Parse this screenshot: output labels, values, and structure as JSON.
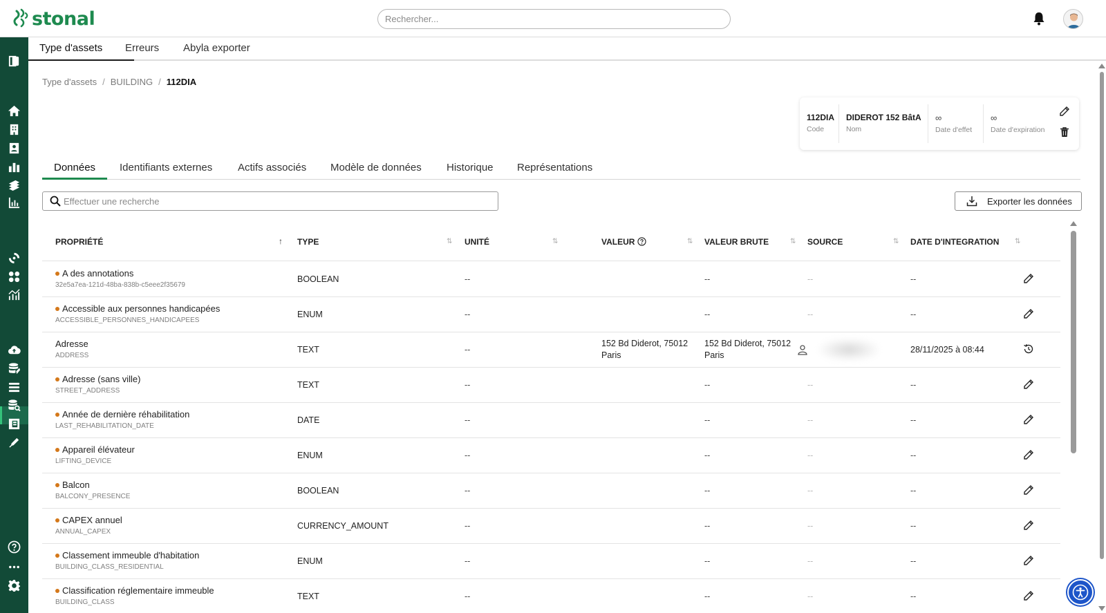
{
  "header": {
    "brand": "stonal",
    "search_placeholder": "Rechercher..."
  },
  "main_tabs": [
    {
      "label": "Type d'assets",
      "active": true
    },
    {
      "label": "Erreurs",
      "active": false
    },
    {
      "label": "Abyla exporter",
      "active": false
    }
  ],
  "breadcrumb": {
    "items": [
      "Type d'assets",
      "BUILDING"
    ],
    "current": "112DIA",
    "separator": "/"
  },
  "info_card": {
    "code_value": "112DIA",
    "code_label": "Code",
    "nom_value": "DIDEROT 152 BâtA",
    "nom_label": "Nom",
    "effet_value": "∞",
    "effet_label": "Date d'effet",
    "expiration_value": "∞",
    "expiration_label": "Date d'expiration"
  },
  "sub_tabs": [
    {
      "label": "Données",
      "active": true
    },
    {
      "label": "Identifiants externes",
      "active": false
    },
    {
      "label": "Actifs associés",
      "active": false
    },
    {
      "label": "Modèle de données",
      "active": false
    },
    {
      "label": "Historique",
      "active": false
    },
    {
      "label": "Représentations",
      "active": false
    }
  ],
  "table_search_placeholder": "Effectuer une recherche",
  "export_label": "Exporter les données",
  "columns": {
    "propriete": "PROPRIÉTÉ",
    "type": "TYPE",
    "unite": "UNITÉ",
    "valeur": "VALEUR",
    "valeur_brute": "VALEUR BRUTE",
    "source": "SOURCE",
    "date_integration": "DATE D'INTEGRATION"
  },
  "sort_glyphs": {
    "asc": "↑",
    "neutral": "⇅"
  },
  "rows": [
    {
      "name": "A des annotations",
      "code": "32e5a7ea-121d-48ba-838b-c5eee2f35679",
      "type": "BOOLEAN",
      "unite": "--",
      "valeur": "",
      "valeur_brute": "--",
      "source": "--",
      "date": "--",
      "icon": "pencil-icon",
      "dot": true
    },
    {
      "name": "Accessible aux personnes handicapées",
      "code": "ACCESSIBLE_PERSONNES_HANDICAPEES",
      "type": "ENUM",
      "unite": "--",
      "valeur": "",
      "valeur_brute": "--",
      "source": "--",
      "date": "--",
      "icon": "pencil-icon",
      "dot": true
    },
    {
      "name": "Adresse",
      "code": "ADDRESS",
      "type": "TEXT",
      "unite": "--",
      "valeur": "152 Bd Diderot, 75012 Paris",
      "valeur_brute": "152 Bd Diderot, 75012 Paris",
      "source": "",
      "date": "28/11/2025 à 08:44",
      "icon": "history-icon",
      "dot": false
    },
    {
      "name": "Adresse (sans ville)",
      "code": "STREET_ADDRESS",
      "type": "TEXT",
      "unite": "--",
      "valeur": "",
      "valeur_brute": "--",
      "source": "--",
      "date": "--",
      "icon": "pencil-icon",
      "dot": true
    },
    {
      "name": "Année de dernière réhabilitation",
      "code": "LAST_REHABILITATION_DATE",
      "type": "DATE",
      "unite": "--",
      "valeur": "",
      "valeur_brute": "--",
      "source": "--",
      "date": "--",
      "icon": "pencil-icon",
      "dot": true
    },
    {
      "name": "Appareil élévateur",
      "code": "LIFTING_DEVICE",
      "type": "ENUM",
      "unite": "--",
      "valeur": "",
      "valeur_brute": "--",
      "source": "--",
      "date": "--",
      "icon": "pencil-icon",
      "dot": true
    },
    {
      "name": "Balcon",
      "code": "BALCONY_PRESENCE",
      "type": "BOOLEAN",
      "unite": "--",
      "valeur": "",
      "valeur_brute": "--",
      "source": "--",
      "date": "--",
      "icon": "pencil-icon",
      "dot": true
    },
    {
      "name": "CAPEX annuel",
      "code": "ANNUAL_CAPEX",
      "type": "CURRENCY_AMOUNT",
      "unite": "--",
      "valeur": "",
      "valeur_brute": "--",
      "source": "--",
      "date": "--",
      "icon": "pencil-icon",
      "dot": true
    },
    {
      "name": "Classement immeuble d'habitation",
      "code": "BUILDING_CLASS_RESIDENTIAL",
      "type": "ENUM",
      "unite": "--",
      "valeur": "",
      "valeur_brute": "--",
      "source": "--",
      "date": "--",
      "icon": "pencil-icon",
      "dot": true
    },
    {
      "name": "Classification réglementaire immeuble",
      "code": "BUILDING_CLASS",
      "type": "TEXT",
      "unite": "--",
      "valeur": "",
      "valeur_brute": "--",
      "source": "--",
      "date": "--",
      "icon": "pencil-icon",
      "dot": true
    }
  ],
  "colors": {
    "brand_green": "#1e8a4f",
    "sidebar_bg": "#124a37",
    "dot_orange": "#d4781a",
    "a11y_blue": "#1d55c9"
  }
}
